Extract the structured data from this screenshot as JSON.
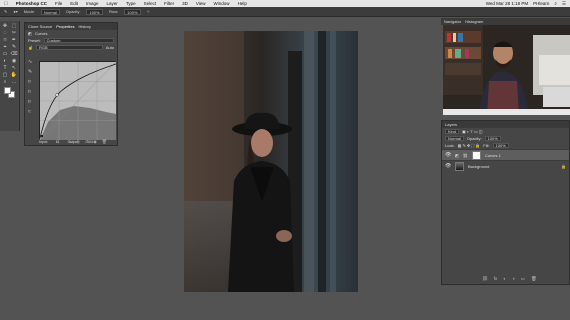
{
  "menubar": {
    "apple": "",
    "items": [
      "Photoshop CC",
      "File",
      "Edit",
      "Image",
      "Layer",
      "Type",
      "Select",
      "Filter",
      "3D",
      "View",
      "Window",
      "Help"
    ],
    "right": {
      "datetime": "Wed Mar 28  1:18 PM",
      "user": "PHlearn",
      "search": "⌕",
      "list": "☰"
    }
  },
  "options": {
    "mode_label": "Mode:",
    "mode": "Normal",
    "opacity_label": "Opacity:",
    "opacity": "100%",
    "flow_label": "Flow:",
    "flow": "100%"
  },
  "tools": [
    "✥",
    "⬚",
    "◌",
    "✂",
    "⌑",
    "✒",
    "⌖",
    "✎",
    "▭",
    "⌫",
    "◐",
    "◉",
    "T",
    "↖",
    "▢",
    "✋",
    "⌕",
    "…"
  ],
  "props": {
    "tabs": [
      "Clone Source",
      "Properties",
      "History"
    ],
    "active_tab": 1,
    "title": "Curves",
    "preset_label": "Preset:",
    "preset": "Custom",
    "channel": "RGB",
    "auto": "Auto",
    "input_label": "Input:",
    "input": "61",
    "output_label": "Output:",
    "output": "104",
    "bottom": [
      "⌂",
      "◎",
      "↺",
      "◉",
      "🗑"
    ]
  },
  "right": {
    "tabs": [
      "Navigator",
      "Histogram"
    ],
    "active_tab": 0
  },
  "layers": {
    "title": "Layers",
    "kind": "Kind",
    "blend": "Normal",
    "opacity_label": "Opacity:",
    "opacity": "100%",
    "lock_label": "Lock:",
    "fill_label": "Fill:",
    "fill": "100%",
    "items": [
      {
        "name": "Curves 1",
        "selected": true,
        "type": "adjustment"
      },
      {
        "name": "Background",
        "selected": false,
        "type": "image",
        "locked": "🔒"
      }
    ],
    "footer": [
      "⛓",
      "fx",
      "◐",
      "◑",
      "▭",
      "🗑"
    ]
  },
  "colors": {
    "bg": "#535353",
    "panel": "#464646",
    "menubar": "#e6e6e6"
  }
}
